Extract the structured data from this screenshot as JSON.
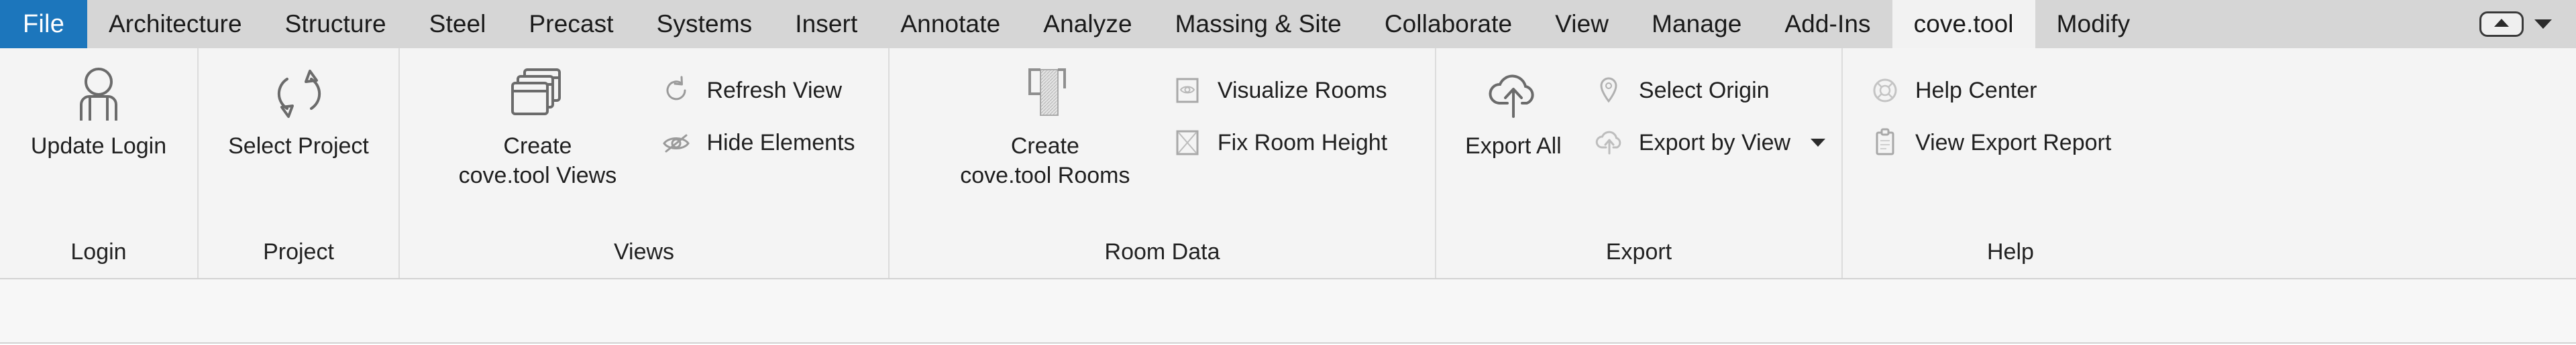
{
  "window": {
    "application": "Autodesk Revit",
    "active_ribbon_tab": "cove.tool"
  },
  "theme": {
    "file_tab_blue": "#1c76bc",
    "tabbar_gray": "#d6d6d6",
    "ribbon_gray": "#f4f4f4",
    "active_tab_gray": "#f2f2f2",
    "divider_gray": "#dcdcdc",
    "icon_stroke": "#6b6b6b",
    "icon_stroke_disabled": "#c9c9c9",
    "text_color": "#1f1f1f"
  },
  "tabbar": {
    "file_tab": "File",
    "tabs": [
      {
        "label": "Architecture",
        "active": false
      },
      {
        "label": "Structure",
        "active": false
      },
      {
        "label": "Steel",
        "active": false
      },
      {
        "label": "Precast",
        "active": false
      },
      {
        "label": "Systems",
        "active": false
      },
      {
        "label": "Insert",
        "active": false
      },
      {
        "label": "Annotate",
        "active": false
      },
      {
        "label": "Analyze",
        "active": false
      },
      {
        "label": "Massing & Site",
        "active": false
      },
      {
        "label": "Collaborate",
        "active": false
      },
      {
        "label": "View",
        "active": false
      },
      {
        "label": "Manage",
        "active": false
      },
      {
        "label": "Add-Ins",
        "active": false
      },
      {
        "label": "cove.tool",
        "active": true
      },
      {
        "label": "Modify",
        "active": false
      }
    ],
    "minimize_ribbon": {
      "icon": "triangle-up-icon",
      "caret": "chevron-down-icon"
    }
  },
  "ribbon": {
    "panels": [
      {
        "title": "Login",
        "big_buttons": [
          {
            "label": "Update Login",
            "icon": "user-person-icon",
            "enabled": true
          }
        ],
        "small_buttons": []
      },
      {
        "title": "Project",
        "big_buttons": [
          {
            "label": "Select Project",
            "icon": "refresh-sync-arrows-icon",
            "enabled": true
          }
        ],
        "small_buttons": []
      },
      {
        "title": "Views",
        "big_buttons": [
          {
            "label": "Create\ncove.tool Views",
            "icon": "stacked-windows-icon",
            "enabled": true
          }
        ],
        "small_buttons": [
          {
            "label": "Refresh View",
            "icon": "refresh-circular-arrow-icon",
            "enabled": true,
            "has_dropdown": false
          },
          {
            "label": "Hide Elements",
            "icon": "eye-slash-hidden-icon",
            "enabled": true,
            "has_dropdown": false
          }
        ]
      },
      {
        "title": "Room Data",
        "big_buttons": [
          {
            "label": "Create\ncove.tool Rooms",
            "icon": "room-boundary-icon",
            "enabled": true
          }
        ],
        "small_buttons": [
          {
            "label": "Visualize Rooms",
            "icon": "eye-in-box-icon",
            "enabled": true,
            "has_dropdown": false
          },
          {
            "label": "Fix Room Height",
            "icon": "x-in-box-icon",
            "enabled": true,
            "has_dropdown": false
          }
        ]
      },
      {
        "title": "Export",
        "big_buttons": [
          {
            "label": "Export All",
            "icon": "cloud-upload-icon",
            "enabled": true
          }
        ],
        "small_buttons": [
          {
            "label": "Select Origin",
            "icon": "map-pin-icon",
            "enabled": true,
            "has_dropdown": false
          },
          {
            "label": "Export by View",
            "icon": "cloud-upload-small-icon",
            "enabled": true,
            "has_dropdown": true
          }
        ]
      },
      {
        "title": "Help",
        "big_buttons": [],
        "small_buttons": [
          {
            "label": "Help Center",
            "icon": "life-ring-help-icon",
            "enabled": true,
            "has_dropdown": false
          },
          {
            "label": "View Export Report",
            "icon": "clipboard-report-icon",
            "enabled": true,
            "has_dropdown": false
          }
        ]
      }
    ]
  },
  "options_bar": {
    "content": ""
  }
}
